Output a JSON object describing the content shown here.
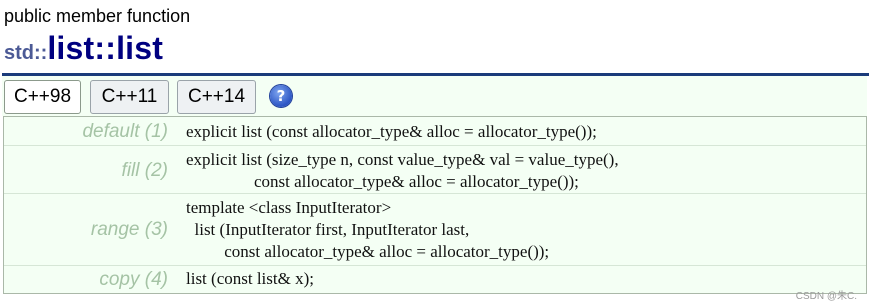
{
  "header": {
    "kind": "public member function",
    "namespace": "std::",
    "name": "list::list"
  },
  "tabs": [
    {
      "label": "C++98",
      "active": true
    },
    {
      "label": "C++11",
      "active": false
    },
    {
      "label": "C++14",
      "active": false
    }
  ],
  "help_glyph": "?",
  "signatures": [
    {
      "label": "default (1)",
      "code": "explicit list (const allocator_type& alloc = allocator_type());"
    },
    {
      "label": "fill (2)",
      "code": "explicit list (size_type n, const value_type& val = value_type(),\n                const allocator_type& alloc = allocator_type());"
    },
    {
      "label": "range (3)",
      "code": "template <class InputIterator>\n  list (InputIterator first, InputIterator last,\n         const allocator_type& alloc = allocator_type());"
    },
    {
      "label": "copy (4)",
      "code": "list (const list& x);"
    }
  ],
  "watermark": "CSDN @朱C.",
  "colors": {
    "title": "#000080",
    "namespace": "#4c5a96",
    "rule": "#1a3b7a",
    "table_bg": "#f4fff4",
    "label": "#a5c3a5"
  }
}
